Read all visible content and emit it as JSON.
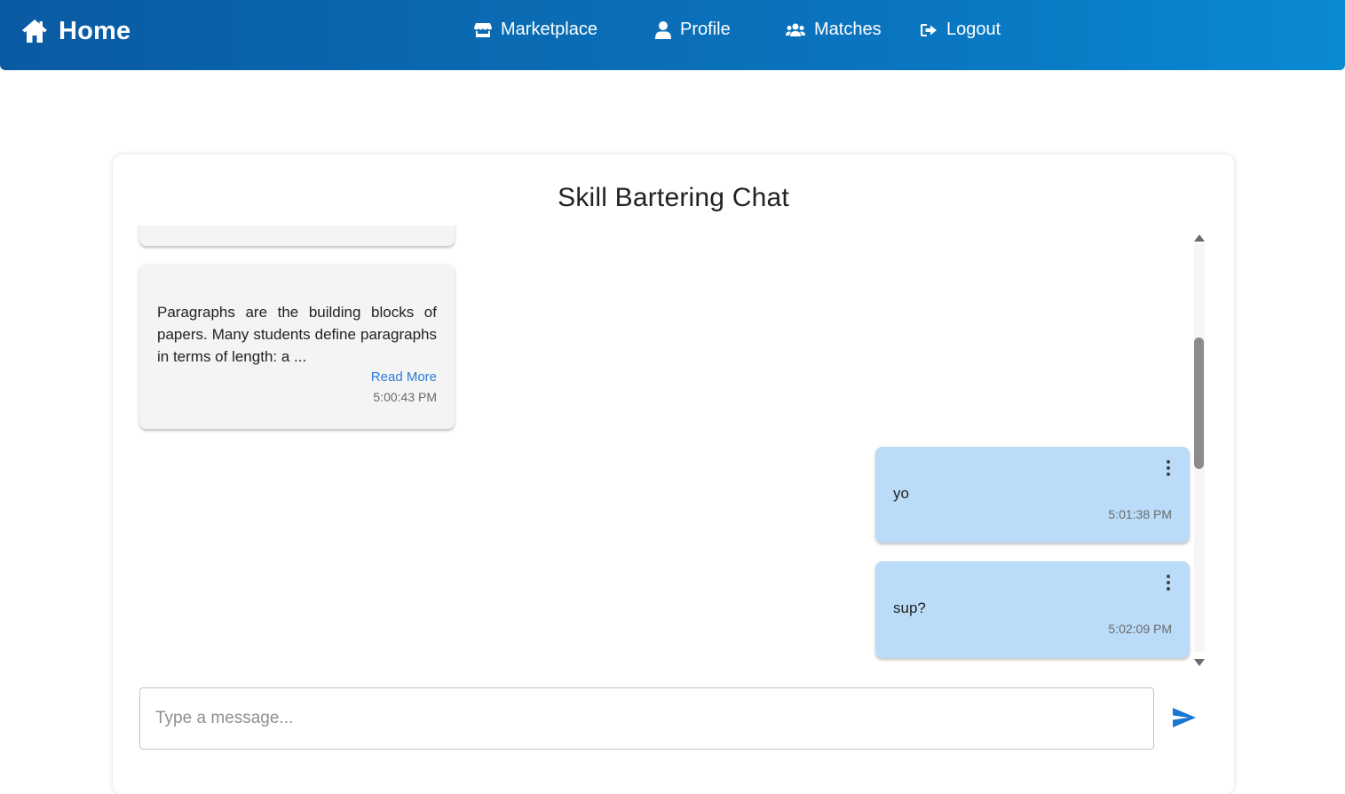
{
  "topbar": {
    "brand": {
      "icon": "home-icon",
      "label": "Home"
    },
    "nav": [
      {
        "icon": "store-icon",
        "label": "Marketplace"
      },
      {
        "icon": "user-icon",
        "label": "Profile"
      },
      {
        "icon": "users-icon",
        "label": "Matches"
      },
      {
        "icon": "logout-icon",
        "label": "Logout"
      }
    ],
    "colors": {
      "gradient_start": "#0a5aa3",
      "gradient_end": "#0a8ad3"
    }
  },
  "chat": {
    "title": "Skill Bartering Chat",
    "messages": [
      {
        "direction": "received",
        "text": "Paragraphs are the building blocks of papers. Many students define paragraphs in terms of length: a ...",
        "read_more": "Read More",
        "time": "5:00:43 PM"
      },
      {
        "direction": "sent",
        "text": "yo",
        "time": "5:01:38 PM",
        "menu_icon": "kebab-menu-icon"
      },
      {
        "direction": "sent",
        "text": "sup?",
        "time": "5:02:09 PM",
        "menu_icon": "kebab-menu-icon"
      }
    ],
    "input": {
      "placeholder": "Type a message...",
      "value": ""
    },
    "send_icon": "send-icon",
    "colors": {
      "received_bubble": "#f4f4f4",
      "sent_bubble": "#bbdcf8",
      "link": "#2d7cd6",
      "send": "#1976d2"
    }
  }
}
